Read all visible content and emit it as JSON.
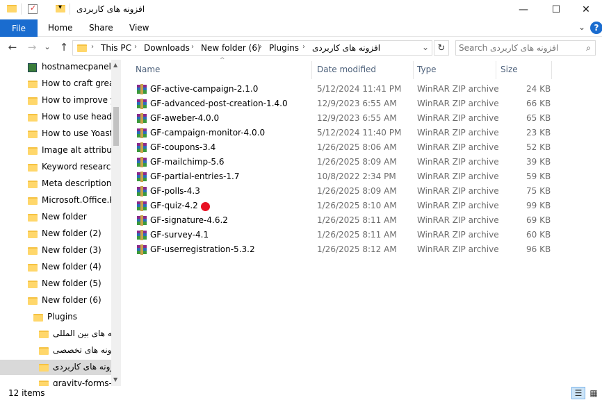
{
  "window": {
    "title": "افزونه های کاربردی",
    "controls": {
      "minimize": "—",
      "maximize": "☐",
      "close": "✕"
    }
  },
  "ribbon": {
    "file": "File",
    "tabs": [
      "Home",
      "Share",
      "View"
    ],
    "help": "?",
    "collapse": "⌄"
  },
  "nav": {
    "back": "←",
    "forward": "→",
    "recent": "⌄",
    "up": "↑",
    "breadcrumb": [
      "This PC",
      "Downloads",
      "New folder (6)",
      "Plugins",
      "افزونه های کاربردی"
    ],
    "sep": "›",
    "dropdown": "⌄",
    "refresh": "↻",
    "search_placeholder": "Search افزونه های کاربردی",
    "search_icon": "⌕"
  },
  "tree": {
    "items": [
      {
        "label": "hostnamecpanelN",
        "icon": "app-icon"
      },
      {
        "label": "How to craft great",
        "icon": "folder-icon"
      },
      {
        "label": "How to improve yo",
        "icon": "folder-icon"
      },
      {
        "label": "How to use headin",
        "icon": "folder-icon"
      },
      {
        "label": "How to use Yoast S",
        "icon": "folder-icon"
      },
      {
        "label": "Image alt attribute",
        "icon": "folder-icon"
      },
      {
        "label": "Keyword research",
        "icon": "folder-icon"
      },
      {
        "label": "Meta descriptions",
        "icon": "folder-icon"
      },
      {
        "label": "Microsoft.Office.P",
        "icon": "folder-icon"
      },
      {
        "label": "New folder",
        "icon": "folder-icon"
      },
      {
        "label": "New folder (2)",
        "icon": "folder-icon"
      },
      {
        "label": "New folder (3)",
        "icon": "folder-icon"
      },
      {
        "label": "New folder (4)",
        "icon": "folder-icon"
      },
      {
        "label": "New folder (5)",
        "icon": "folder-icon"
      },
      {
        "label": "New folder (6)",
        "icon": "folder-icon"
      },
      {
        "label": "Plugins",
        "icon": "folder-icon"
      },
      {
        "label": "افزونه های بین المللی",
        "icon": "folder-icon"
      },
      {
        "label": "افزونه های تخصصی",
        "icon": "folder-icon"
      },
      {
        "label": "افزونه های کاربردی",
        "icon": "folder-icon",
        "selected": true
      },
      {
        "label": "gravity-forms-ad",
        "icon": "folder-icon"
      }
    ],
    "scroll_up": "▲",
    "scroll_down": "▼"
  },
  "columns": {
    "name": "Name",
    "date": "Date modified",
    "type": "Type",
    "size": "Size",
    "sort_indicator": "^"
  },
  "files": [
    {
      "name": "GF-active-campaign-2.1.0",
      "date": "5/12/2024 11:41 PM",
      "type": "WinRAR ZIP archive",
      "size": "24 KB"
    },
    {
      "name": "GF-advanced-post-creation-1.4.0",
      "date": "12/9/2023 6:55 AM",
      "type": "WinRAR ZIP archive",
      "size": "66 KB"
    },
    {
      "name": "GF-aweber-4.0.0",
      "date": "12/9/2023 6:55 AM",
      "type": "WinRAR ZIP archive",
      "size": "65 KB"
    },
    {
      "name": "GF-campaign-monitor-4.0.0",
      "date": "5/12/2024 11:40 PM",
      "type": "WinRAR ZIP archive",
      "size": "23 KB"
    },
    {
      "name": "GF-coupons-3.4",
      "date": "1/26/2025 8:06 AM",
      "type": "WinRAR ZIP archive",
      "size": "52 KB"
    },
    {
      "name": "GF-mailchimp-5.6",
      "date": "1/26/2025 8:09 AM",
      "type": "WinRAR ZIP archive",
      "size": "39 KB"
    },
    {
      "name": "GF-partial-entries-1.7",
      "date": "10/8/2022 2:34 PM",
      "type": "WinRAR ZIP archive",
      "size": "59 KB"
    },
    {
      "name": "GF-polls-4.3",
      "date": "1/26/2025 8:09 AM",
      "type": "WinRAR ZIP archive",
      "size": "75 KB"
    },
    {
      "name": "GF-quiz-4.2",
      "date": "1/26/2025 8:10 AM",
      "type": "WinRAR ZIP archive",
      "size": "99 KB",
      "marker": true
    },
    {
      "name": "GF-signature-4.6.2",
      "date": "1/26/2025 8:11 AM",
      "type": "WinRAR ZIP archive",
      "size": "69 KB"
    },
    {
      "name": "GF-survey-4.1",
      "date": "1/26/2025 8:11 AM",
      "type": "WinRAR ZIP archive",
      "size": "60 KB"
    },
    {
      "name": "GF-userregistration-5.3.2",
      "date": "1/26/2025 8:12 AM",
      "type": "WinRAR ZIP archive",
      "size": "96 KB"
    }
  ],
  "status": {
    "count": "12 items",
    "details_view": "☰",
    "tiles_view": "▦"
  },
  "colors": {
    "accent": "#1a6ccf",
    "marker": "#e81123",
    "folder": "#ffd76b"
  }
}
